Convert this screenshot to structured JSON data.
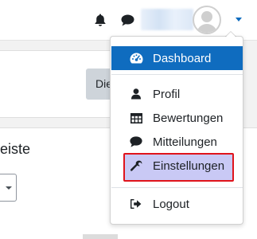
{
  "navbar": {
    "icons": [
      "bell-icon",
      "chat-icon",
      "user-avatar-icon",
      "caret-down-icon"
    ],
    "username_blurred": true
  },
  "background": {
    "button_fragment": "Die",
    "heading_fragment": "eiste"
  },
  "user_menu": {
    "items": [
      {
        "label": "Dashboard",
        "icon": "dashboard-gauge-icon",
        "active": true
      },
      {
        "label": "Profil",
        "icon": "user-icon"
      },
      {
        "label": "Bewertungen",
        "icon": "table-icon"
      },
      {
        "label": "Mitteilungen",
        "icon": "comment-icon"
      },
      {
        "label": "Einstellungen",
        "icon": "wrench-icon",
        "highlighted": true
      },
      {
        "label": "Logout",
        "icon": "sign-out-icon"
      }
    ]
  },
  "colors": {
    "accent": "#0f6cbf",
    "highlight_fill": "#c9c9f5",
    "highlight_border": "#e0141c",
    "icon_dark": "#1d2125"
  }
}
